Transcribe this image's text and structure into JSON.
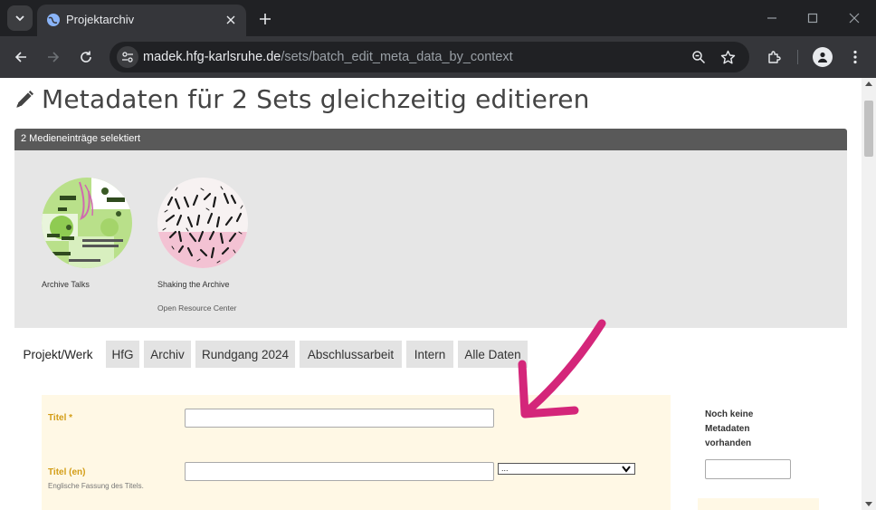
{
  "browser": {
    "tab_title": "Projektarchiv",
    "url_host": "madek.hfg-karlsruhe.de",
    "url_path": "/sets/batch_edit_meta_data_by_context",
    "icons": [
      "tab-search-icon",
      "globe-icon",
      "close-icon",
      "plus-icon",
      "minimize-icon",
      "maximize-icon",
      "window-close-icon",
      "back-icon",
      "forward-icon",
      "reload-icon",
      "site-info-icon",
      "zoom-icon",
      "star-icon",
      "extensions-icon",
      "profile-icon",
      "menu-icon"
    ]
  },
  "page": {
    "title": "Metadaten für 2 Sets gleichzeitig editieren",
    "selection_header": "2 Medieneinträge selektiert",
    "selected_items": [
      {
        "label": "Archive Talks",
        "subtitle": ""
      },
      {
        "label": "Shaking the Archive",
        "subtitle": "Open Resource Center"
      }
    ],
    "tabs": [
      "Projekt/Werk",
      "HfG",
      "Archiv",
      "Rundgang 2024",
      "Abschlussarbeit",
      "Intern",
      "Alle Daten"
    ],
    "active_tab": "Projekt/Werk",
    "fields": [
      {
        "label": "Titel *",
        "hint": "",
        "value": ""
      },
      {
        "label": "Titel (en)",
        "hint": "Englische Fassung des Titels.",
        "value": "",
        "select_value": "..."
      }
    ],
    "sidebar": {
      "title": "Noch keine Metadaten vorhanden",
      "input_value": ""
    },
    "colors": {
      "field_label": "#d39d17",
      "form_bg": "#fff8e5",
      "header_bg": "#595959",
      "arrow": "#d4267a"
    }
  }
}
